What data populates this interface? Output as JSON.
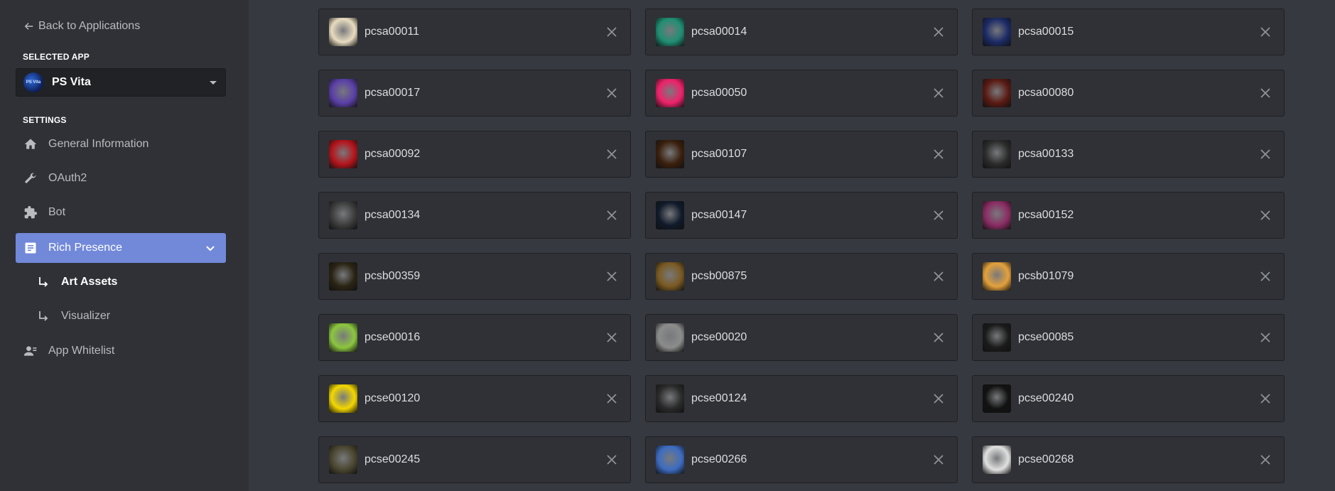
{
  "sidebar": {
    "back_label": "Back to Applications",
    "selected_app_heading": "SELECTED APP",
    "selected_app": {
      "name": "PS Vita",
      "icon_text": "PS Vita"
    },
    "settings_heading": "SETTINGS",
    "items": [
      {
        "label": "General Information",
        "icon": "home-icon"
      },
      {
        "label": "OAuth2",
        "icon": "wrench-icon"
      },
      {
        "label": "Bot",
        "icon": "puzzle-icon"
      },
      {
        "label": "Rich Presence",
        "icon": "document-icon",
        "active": true
      },
      {
        "label": "App Whitelist",
        "icon": "person-card-icon"
      }
    ],
    "sub_items": [
      {
        "label": "Art Assets",
        "current": true
      },
      {
        "label": "Visualizer"
      }
    ],
    "accent_color": "#7289da"
  },
  "assets": [
    {
      "name": "pcsa00011",
      "color": "#e8dcc0"
    },
    {
      "name": "pcsa00014",
      "color": "#1f8f74"
    },
    {
      "name": "pcsa00015",
      "color": "#1c2a66"
    },
    {
      "name": "pcsa00017",
      "color": "#5b3fa8"
    },
    {
      "name": "pcsa00050",
      "color": "#f0216a"
    },
    {
      "name": "pcsa00080",
      "color": "#5a1a12"
    },
    {
      "name": "pcsa00092",
      "color": "#b5141b"
    },
    {
      "name": "pcsa00107",
      "color": "#3a1f0c"
    },
    {
      "name": "pcsa00133",
      "color": "#2b2b2b"
    },
    {
      "name": "pcsa00134",
      "color": "#3c3c3c"
    },
    {
      "name": "pcsa00147",
      "color": "#101a2a"
    },
    {
      "name": "pcsa00152",
      "color": "#8a2c63"
    },
    {
      "name": "pcsb00359",
      "color": "#2a2414"
    },
    {
      "name": "pcsb00875",
      "color": "#7a5a22"
    },
    {
      "name": "pcsb01079",
      "color": "#e4a13b"
    },
    {
      "name": "pcse00016",
      "color": "#8cc63f"
    },
    {
      "name": "pcse00020",
      "color": "#8c8c8c"
    },
    {
      "name": "pcse00085",
      "color": "#1b1b1b"
    },
    {
      "name": "pcse00120",
      "color": "#f3d800"
    },
    {
      "name": "pcse00124",
      "color": "#2a2a2a"
    },
    {
      "name": "pcse00240",
      "color": "#121212"
    },
    {
      "name": "pcse00245",
      "color": "#4a4630"
    },
    {
      "name": "pcse00266",
      "color": "#3d6cc2"
    },
    {
      "name": "pcse00268",
      "color": "#e0e0e0"
    }
  ]
}
